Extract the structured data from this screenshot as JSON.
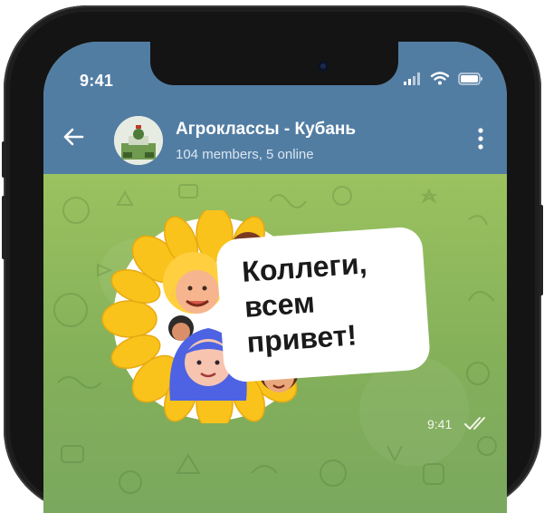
{
  "status_bar": {
    "time": "9:41"
  },
  "header": {
    "title": "Агроклассы - Кубань",
    "subtitle": "104 members, 5 online"
  },
  "message": {
    "sticker_text_line1": "Коллеги,",
    "sticker_text_line2": "всем",
    "sticker_text_line3": "привет!",
    "time": "9:41"
  },
  "colors": {
    "header_bg": "#527da3",
    "chat_bg": "#8db765",
    "phone_frame": "#141414",
    "petal": "#f9c31c"
  }
}
